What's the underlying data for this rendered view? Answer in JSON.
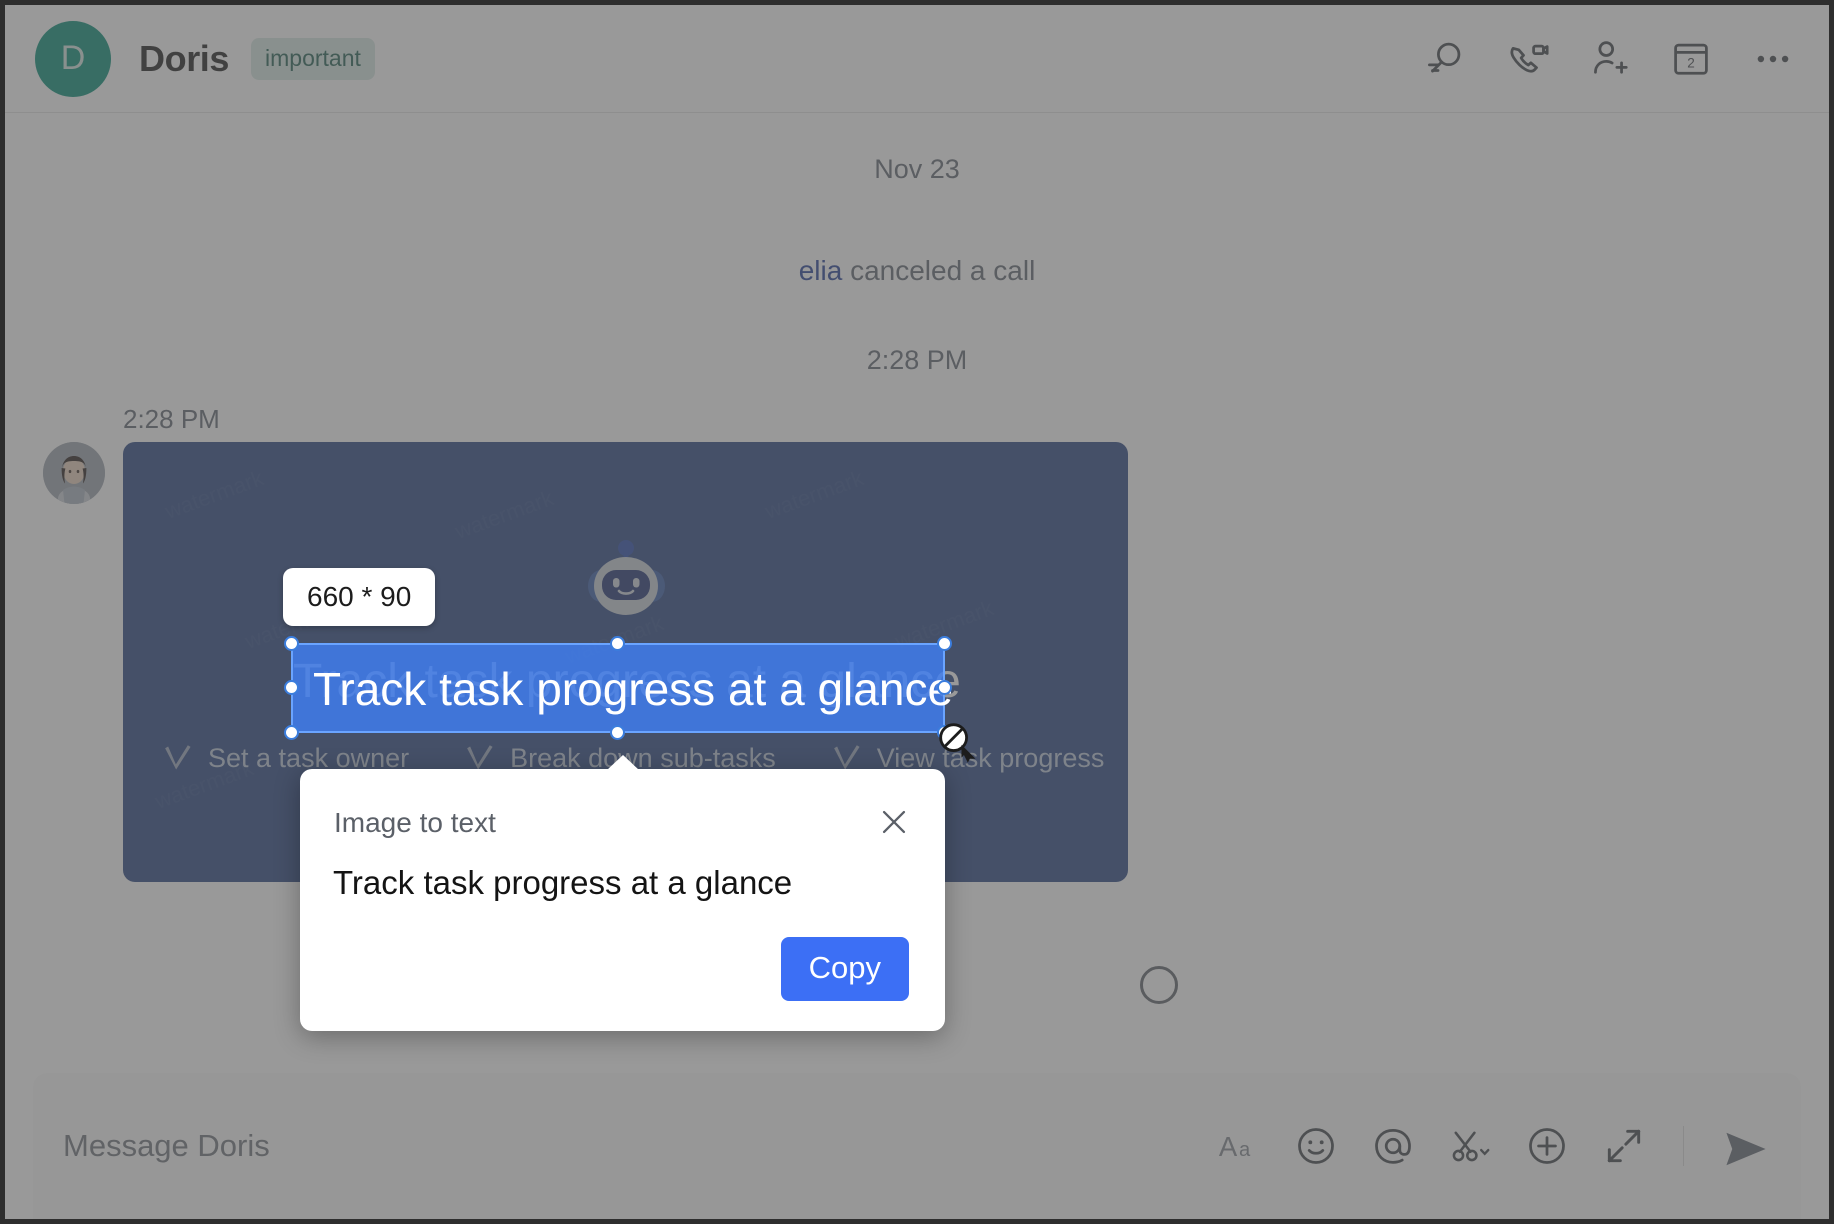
{
  "header": {
    "avatar_initial": "D",
    "title": "Doris",
    "tag": "important",
    "accent_color": "#008b74",
    "actions": [
      {
        "name": "search-icon",
        "label": "Search"
      },
      {
        "name": "video-call-icon",
        "label": "Video call"
      },
      {
        "name": "add-person-icon",
        "label": "Add people"
      },
      {
        "name": "calendar-icon",
        "label": "Calendar",
        "badge": "2"
      },
      {
        "name": "more-options-icon",
        "label": "More options"
      }
    ]
  },
  "conversation": {
    "date_divider": "Nov 23",
    "call_event": {
      "actor": "elia",
      "text": "canceled a call"
    },
    "call_event_time": "2:28 PM",
    "message_time": "2:28 PM"
  },
  "promo_card": {
    "background_color": "#23407e",
    "headline": "Track task progress at a glance",
    "features": [
      "Set a task owner",
      "Break down sub-tasks",
      "View task progress"
    ],
    "mascot": "bot-mascot-icon"
  },
  "selection": {
    "size_badge": "660 * 90",
    "selected_text": "Track task progress at a glance",
    "selection_color": "#407ef0",
    "handle_count": 8,
    "cursor": "no-drop-cursor"
  },
  "ocr_popover": {
    "title": "Image to text",
    "recognized_text": "Track task progress at a glance",
    "copy_label": "Copy",
    "copy_color": "#3c6ff5",
    "close_icon": "close-icon"
  },
  "composer": {
    "placeholder": "Message Doris",
    "value": "",
    "actions": [
      {
        "name": "format-text-icon",
        "label": "Aa"
      },
      {
        "name": "emoji-icon",
        "label": "Emoji"
      },
      {
        "name": "mention-icon",
        "label": "Mention"
      },
      {
        "name": "scissors-icon",
        "label": "Screenshot"
      },
      {
        "name": "plus-icon",
        "label": "More"
      },
      {
        "name": "expand-icon",
        "label": "Expand"
      },
      {
        "name": "send-icon",
        "label": "Send"
      }
    ]
  }
}
